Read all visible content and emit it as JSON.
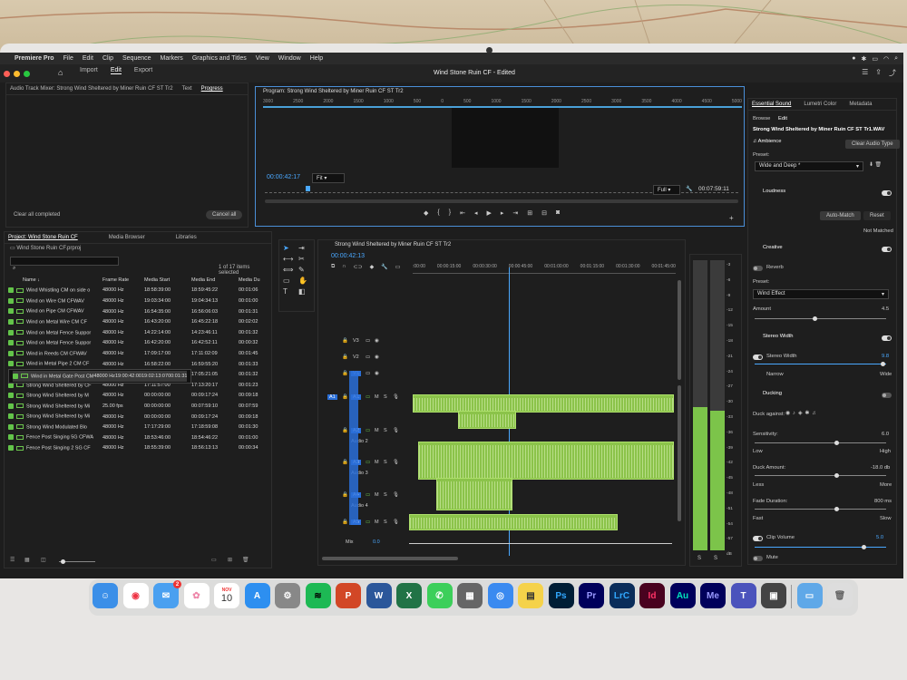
{
  "app": {
    "name": "Premiere Pro",
    "window_title": "Wind Stone Ruin CF - Edited"
  },
  "menu": [
    "File",
    "Edit",
    "Clip",
    "Sequence",
    "Markers",
    "Graphics and Titles",
    "View",
    "Window",
    "Help"
  ],
  "top_tabs": [
    "Import",
    "Edit",
    "Export"
  ],
  "left_top": {
    "tabs": [
      "Audio Track Mixer: Strong Wind Sheltered by Miner Ruin CF ST Tr2",
      "Text",
      "Progress"
    ],
    "clear_label": "Clear all completed",
    "cancel_label": "Cancel all"
  },
  "program": {
    "title": "Program: Strong Wind Sheltered by Miner Ruin CF ST Tr2",
    "timecode": "00:00:42:17",
    "fit": "Fit",
    "quality": "Full",
    "duration": "00:07:59:11",
    "ruler": [
      "3000",
      "2500",
      "2000",
      "1500",
      "1000",
      "500",
      "0",
      "500",
      "1000",
      "1500",
      "2000",
      "2500",
      "3000",
      "3500",
      "4000",
      "4500",
      "5000"
    ]
  },
  "project": {
    "tabs": [
      "Project: Wind Stone Ruin CF",
      "Media Browser",
      "Libraries"
    ],
    "file": "Wind Stone Ruin CF.prproj",
    "selection": "1 of 17 items selected",
    "columns": [
      "Name",
      "Frame Rate",
      "Media Start",
      "Media End",
      "Media Du"
    ],
    "rows": [
      [
        "Wind Whistling CM on side o",
        "48000 Hz",
        "18:58:39:00",
        "18:59:45:22",
        "00:01:06"
      ],
      [
        "Wind on Wire CM CFWAV",
        "48000 Hz",
        "19:03:34:00",
        "19:04:34:13",
        "00:01:00"
      ],
      [
        "Wind on Pipe CM CFWAV",
        "48000 Hz",
        "16:54:35:00",
        "16:56:06:03",
        "00:01:31"
      ],
      [
        "Wind on Metal Wire CM CF",
        "48000 Hz",
        "16:43:20:00",
        "16:45:22:18",
        "00:02:02"
      ],
      [
        "Wind on Metal Fence Suppor",
        "48000 Hz",
        "14:22:14:00",
        "14:23:46:11",
        "00:01:32"
      ],
      [
        "Wind on Metal Fence Suppor",
        "48000 Hz",
        "16:42:20:00",
        "16:42:52:11",
        "00:00:32"
      ],
      [
        "Wind in Reeds CM CFWAV",
        "48000 Hz",
        "17:09:17:00",
        "17:11:02:09",
        "00:01:45"
      ],
      [
        "Wind in Metal Pipe 2 CM CF",
        "48000 Hz",
        "16:58:22:00",
        "16:59:55:20",
        "00:01:33"
      ],
      [
        "Wind in Metal Gate Post CM",
        "48000 Hz",
        "19:00:42:00",
        "19:02:13:07",
        "00:01:31"
      ],
      [
        "Wind in Metal Container CM",
        "48000 Hz",
        "17:03:49:00",
        "17:05:21:05",
        "00:01:32"
      ],
      [
        "Strong Wind Sheltered by CF",
        "48000 Hz",
        "17:11:57:00",
        "17:13:20:17",
        "00:01:23"
      ],
      [
        "Strong Wind Sheltered by M",
        "48000 Hz",
        "00:00:00:00",
        "00:09:17:24",
        "00:09:18"
      ],
      [
        "Strong Wind Sheltered by Mi",
        "25.00 fps",
        "00:00:00:00",
        "00:07:59:10",
        "00:07:59"
      ],
      [
        "Strong Wind Sheltered by Mi",
        "48000 Hz",
        "00:00:00:00",
        "00:09:17:24",
        "00:09:18"
      ],
      [
        "Strong Wind Modulated Blo",
        "48000 Hz",
        "17:17:29:00",
        "17:18:59:08",
        "00:01:30"
      ],
      [
        "Fence Post Singing 5G CFWA",
        "48000 Hz",
        "18:53:46:00",
        "18:54:46:22",
        "00:01:00"
      ],
      [
        "Fence Post Singing 2 SG CF",
        "48000 Hz",
        "18:55:39:00",
        "18:56:13:13",
        "00:00:34"
      ]
    ],
    "selected_index": 8
  },
  "timeline": {
    "title": "Strong Wind Sheltered by Miner Ruin CF ST Tr2",
    "timecode": "00:00:42:13",
    "ruler": [
      ":00:00",
      "00:00:15:00",
      "00:00:30:00",
      "00:00:45:00",
      "00:01:00:00",
      "00:01:15:00",
      "00:01:30:00",
      "00:01:45:00"
    ],
    "video_tracks": [
      "V3",
      "V2",
      "V1"
    ],
    "audio_tracks": [
      {
        "id": "A1",
        "name": ""
      },
      {
        "id": "A2",
        "name": "Audio 2"
      },
      {
        "id": "A3",
        "name": "Audio 3"
      },
      {
        "id": "A4",
        "name": "Audio 4"
      },
      {
        "id": "A5",
        "name": ""
      }
    ],
    "mix_label": "Mix",
    "mix_value": "0.0"
  },
  "meter_scale": [
    "-3",
    "-6",
    "-9",
    "-12",
    "-15",
    "-18",
    "-21",
    "-24",
    "-27",
    "-30",
    "-33",
    "-36",
    "-39",
    "-42",
    "-45",
    "-48",
    "-51",
    "-54",
    "-57",
    "dB"
  ],
  "essential_sound": {
    "tabs": [
      "Essential Sound",
      "Lumetri Color",
      "Metadata"
    ],
    "subtabs": [
      "Browse",
      "Edit"
    ],
    "clip": "Strong Wind Sheltered by Miner Ruin CF ST Tr1.WAV",
    "type": "Ambience",
    "clear_type": "Clear Audio Type",
    "preset_label": "Preset:",
    "preset": "Wide and Deep *",
    "loudness": "Loudness",
    "auto_match": "Auto-Match",
    "reset": "Reset",
    "not_matched": "Not Matched",
    "creative": "Creative",
    "reverb": "Reverb",
    "reverb_preset": "Wind Effect",
    "amount": "Amount",
    "amount_value": "4.5",
    "stereo_width": "Stereo Width",
    "stereo_width_value": "9.8",
    "narrow": "Narrow",
    "wide": "Wide",
    "ducking": "Ducking",
    "duck_against": "Duck against:",
    "sensitivity": "Sensitivity:",
    "sensitivity_value": "6.0",
    "low": "Low",
    "high": "High",
    "duck_amount": "Duck Amount:",
    "duck_amount_value": "-18.0 db",
    "less": "Less",
    "more": "More",
    "fade_duration": "Fade Duration:",
    "fade_duration_value": "800 ms",
    "fast": "Fast",
    "slow": "Slow",
    "clip_volume": "Clip Volume",
    "clip_volume_value": "5.0",
    "mute": "Mute"
  },
  "dock": {
    "calendar_month": "NOV",
    "calendar_day": "10",
    "mail_badge": "2",
    "apps": [
      "Finder",
      "Chrome",
      "Mail",
      "Photos",
      "Calendar",
      "App Store",
      "Settings",
      "Spotify",
      "PowerPoint",
      "Word",
      "Excel",
      "Messages",
      "Calculator",
      "Safari",
      "Notes",
      "Ps",
      "Pr",
      "LrC",
      "Id",
      "Au",
      "Me",
      "Teams",
      "Notebook",
      "Downloads",
      "Trash"
    ]
  }
}
